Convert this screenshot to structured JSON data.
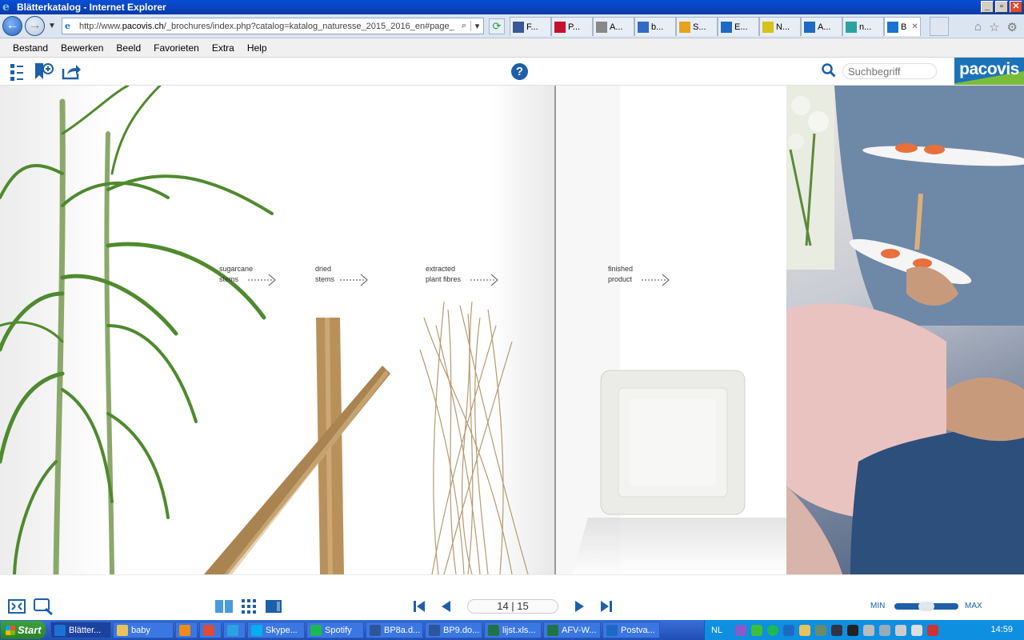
{
  "window": {
    "title": "Blätterkatalog - Internet Explorer",
    "buttons": {
      "minimize": "_",
      "maximize": "▫",
      "close": "✕"
    }
  },
  "navbar": {
    "address_prefix": "http://www.",
    "address_domain": "pacovis.ch",
    "address_rest": "/_brochures/index.php?catalog=katalog_naturesse_2015_2016_en#page_",
    "tabs": [
      {
        "label": "F...",
        "icon": "f-icon",
        "color": "#3b5998"
      },
      {
        "label": "P...",
        "icon": "hlm-icon",
        "color": "#c8102e"
      },
      {
        "label": "A...",
        "icon": "doc-icon",
        "color": "#888888"
      },
      {
        "label": "b...",
        "icon": "globe-icon",
        "color": "#2f6bc9"
      },
      {
        "label": "S...",
        "icon": "circle-icon",
        "color": "#e8a21c"
      },
      {
        "label": "E...",
        "icon": "outlook-icon",
        "color": "#1c6ac4"
      },
      {
        "label": "N...",
        "icon": "sun-icon",
        "color": "#d6c21c"
      },
      {
        "label": "A...",
        "icon": "shield-icon",
        "color": "#1c6ac4"
      },
      {
        "label": "n...",
        "icon": "site-icon",
        "color": "#2aa3a0"
      },
      {
        "label": "B",
        "icon": "ie-icon",
        "color": "#1b73d1",
        "active": true
      }
    ]
  },
  "menubar": [
    "Bestand",
    "Bewerken",
    "Beeld",
    "Favorieten",
    "Extra",
    "Help"
  ],
  "toolbar": {
    "search_placeholder": "Suchbegriff",
    "logo": "pacovis"
  },
  "catalog": {
    "labels": [
      {
        "line1": "sugarcane",
        "line2": "stems"
      },
      {
        "line1": "dried",
        "line2": "stems"
      },
      {
        "line1": "extracted",
        "line2": "plant fibres"
      },
      {
        "line1": "finished",
        "line2": "product"
      }
    ]
  },
  "viewer": {
    "page_indicator": "14 | 15",
    "zoom_min": "MIN",
    "zoom_max": "MAX",
    "zoom_level": 0.5
  },
  "taskbar": {
    "start": "Start",
    "items": [
      {
        "label": "Blätter...",
        "icon": "ie-icon",
        "color": "#1b73d1",
        "active": true
      },
      {
        "label": "baby",
        "icon": "folder-icon",
        "color": "#e8c25c"
      },
      {
        "label": "",
        "icon": "media-icon",
        "color": "#f08a1c"
      },
      {
        "label": "",
        "icon": "chrome-icon",
        "color": "#dd4b39"
      },
      {
        "label": "",
        "icon": "q-icon",
        "color": "#2aa3e0"
      },
      {
        "label": "Skype...",
        "icon": "skype-icon",
        "color": "#00aff0"
      },
      {
        "label": "Spotify",
        "icon": "spotify-icon",
        "color": "#1db954"
      },
      {
        "label": "BP8a.d...",
        "icon": "word-icon",
        "color": "#2b579a"
      },
      {
        "label": "BP9.do...",
        "icon": "word-icon",
        "color": "#2b579a"
      },
      {
        "label": "lijst.xls...",
        "icon": "excel-icon",
        "color": "#217346"
      },
      {
        "label": "AFV-W...",
        "icon": "excel-icon",
        "color": "#217346"
      },
      {
        "label": "Postva...",
        "icon": "outlook-icon",
        "color": "#1c6ac4"
      }
    ],
    "lang": "NL",
    "clock": "14:59"
  }
}
